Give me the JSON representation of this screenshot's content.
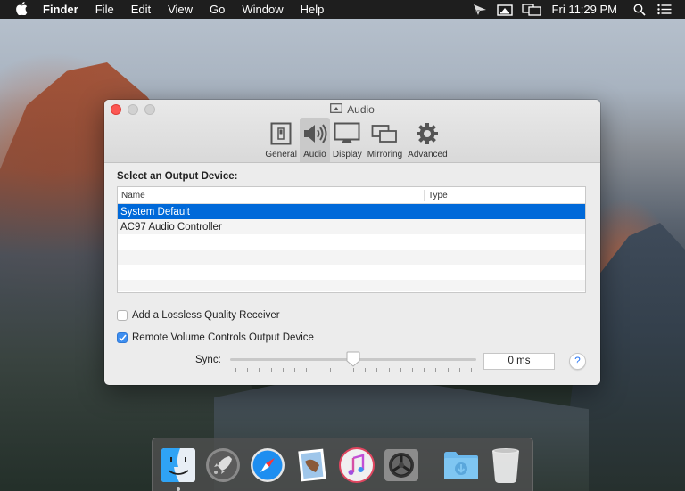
{
  "menubar": {
    "apple_icon": "apple-logo",
    "app_name": "Finder",
    "menus": [
      "File",
      "Edit",
      "View",
      "Go",
      "Window",
      "Help"
    ],
    "status_icons": [
      "airplay-receiver-icon",
      "airplay-audio-icon",
      "display-mirroring-icon"
    ],
    "clock": "Fri 11:29 PM",
    "spotlight_icon": "search-icon",
    "notification_icon": "list-icon"
  },
  "window": {
    "title": "Audio",
    "title_icon": "airplay-audio-icon",
    "tabs": [
      {
        "label": "General",
        "icon": "switch-icon",
        "active": false
      },
      {
        "label": "Audio",
        "icon": "speaker-icon",
        "active": true
      },
      {
        "label": "Display",
        "icon": "monitor-icon",
        "active": false
      },
      {
        "label": "Mirroring",
        "icon": "mirroring-icon",
        "active": false
      },
      {
        "label": "Advanced",
        "icon": "gear-icon",
        "active": false
      }
    ],
    "section_label": "Select an Output Device:",
    "table": {
      "columns": [
        "Name",
        "Type"
      ],
      "rows": [
        {
          "name": "System Default",
          "type": "",
          "selected": true
        },
        {
          "name": "AC97 Audio Controller",
          "type": "",
          "selected": false
        }
      ]
    },
    "checkboxes": [
      {
        "label": "Add a Lossless Quality Receiver",
        "checked": false
      },
      {
        "label": "Remote Volume Controls Output Device",
        "checked": true
      }
    ],
    "sync": {
      "label": "Sync:",
      "value_text": "0 ms",
      "slider_fraction": 0.5,
      "tick_count": 21
    },
    "help_label": "?"
  },
  "dock": {
    "apps": [
      {
        "name": "Finder",
        "running": true
      },
      {
        "name": "Launchpad",
        "running": false
      },
      {
        "name": "Safari",
        "running": false
      },
      {
        "name": "Mail",
        "running": false
      },
      {
        "name": "iTunes",
        "running": false
      },
      {
        "name": "System Preferences",
        "running": false
      }
    ],
    "others": [
      {
        "name": "Downloads"
      },
      {
        "name": "Trash"
      }
    ]
  },
  "colors": {
    "selection": "#0069d9",
    "close_button": "#fc5753",
    "checkbox_checked": "#3d8ef0",
    "help_glyph": "#2f7bf5"
  }
}
